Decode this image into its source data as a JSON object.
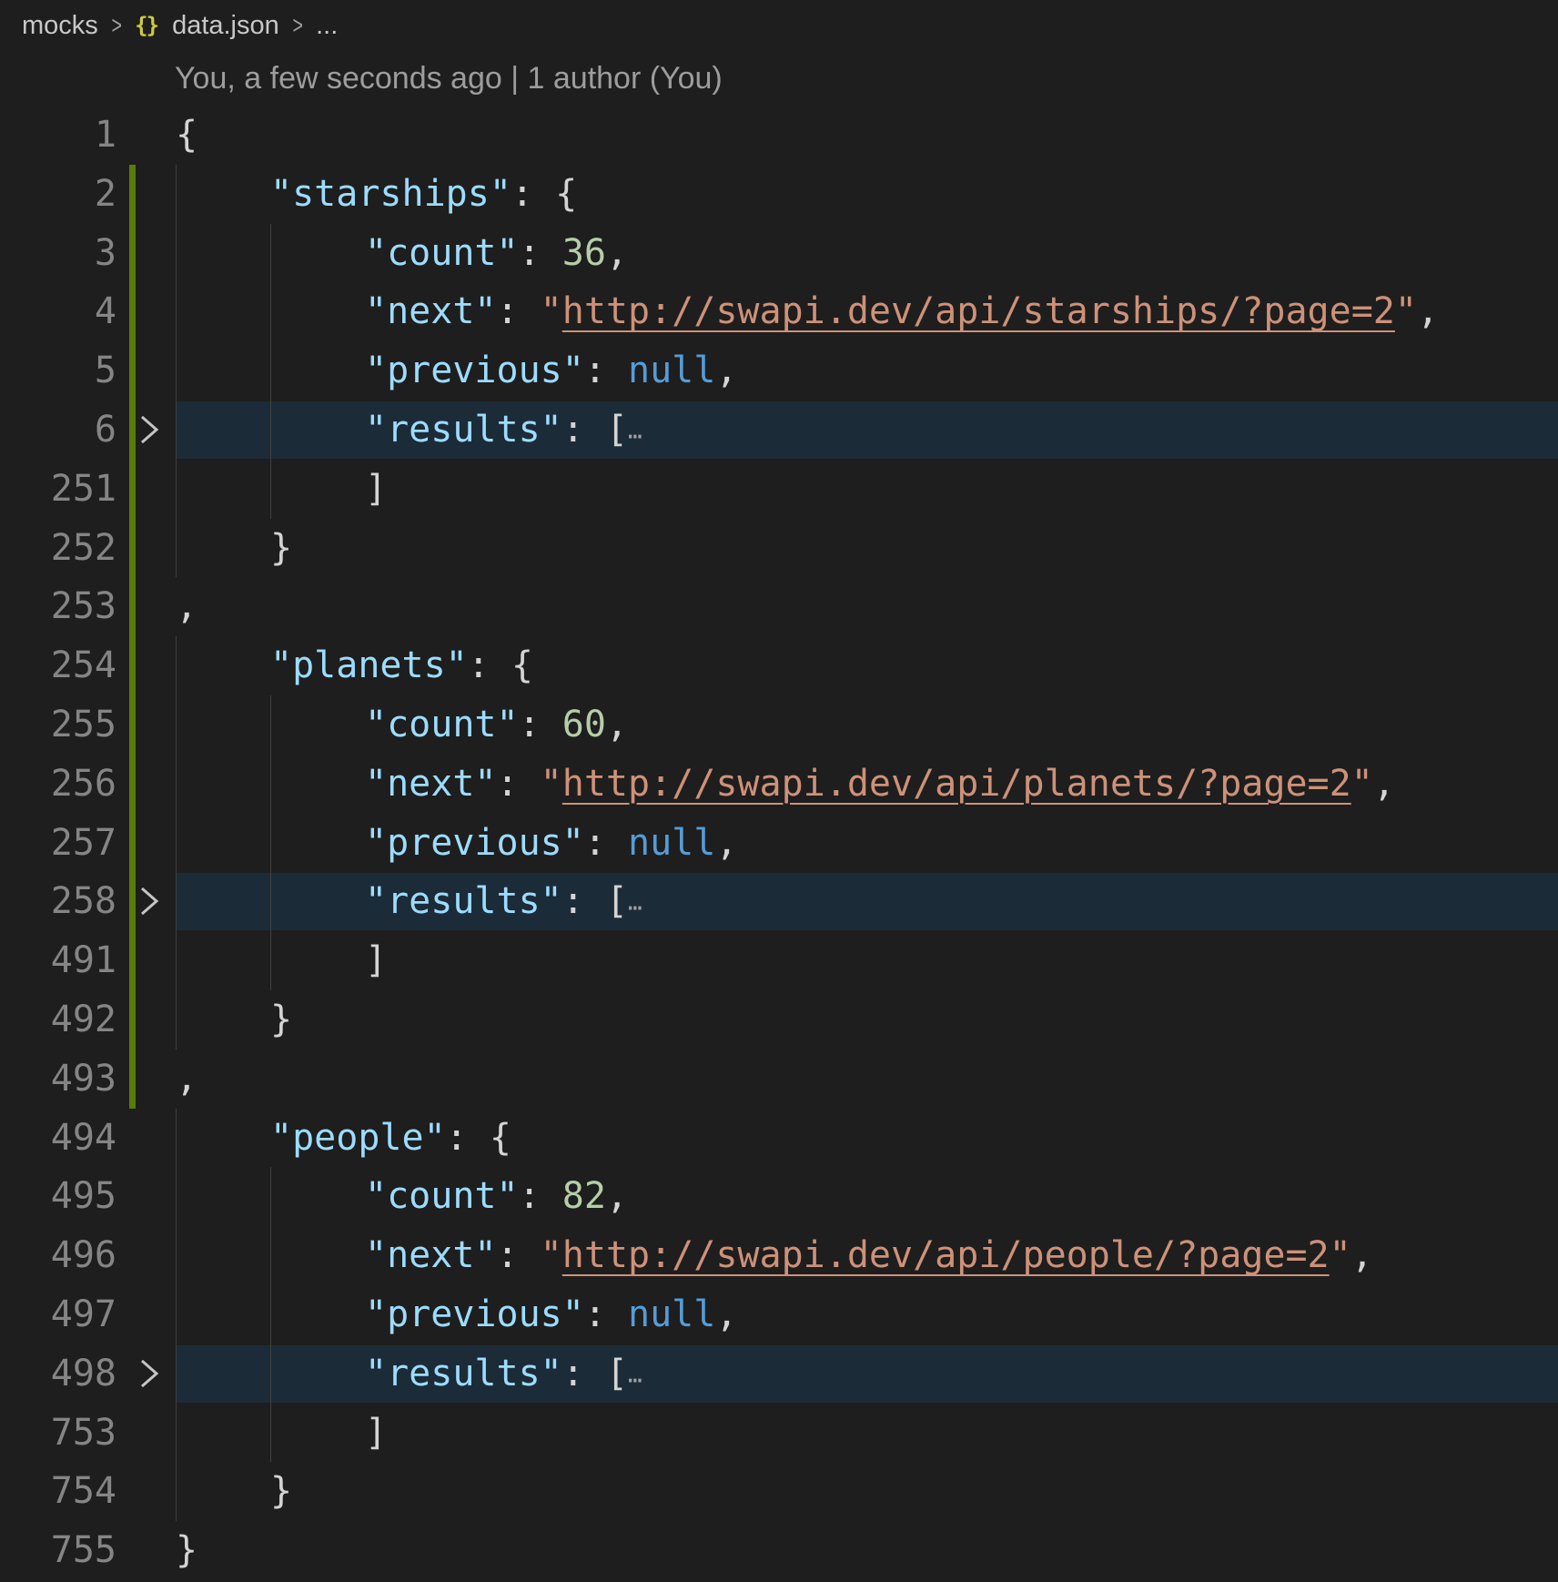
{
  "breadcrumb": {
    "folder": "mocks",
    "file_icon": "{}",
    "file": "data.json",
    "trail": "..."
  },
  "blame": "You, a few seconds ago | 1 author (You)",
  "lines": [
    {
      "n": "1",
      "indent": 0,
      "tokens": [
        [
          "punc",
          "{"
        ]
      ]
    },
    {
      "n": "2",
      "indent": 1,
      "bar": true,
      "tokens": [
        [
          "key",
          "\"starships\""
        ],
        [
          "punc",
          ": {"
        ]
      ]
    },
    {
      "n": "3",
      "indent": 2,
      "bar": true,
      "tokens": [
        [
          "key",
          "\"count\""
        ],
        [
          "punc",
          ": "
        ],
        [
          "num",
          "36"
        ],
        [
          "punc",
          ","
        ]
      ]
    },
    {
      "n": "4",
      "indent": 2,
      "bar": true,
      "tokens": [
        [
          "key",
          "\"next\""
        ],
        [
          "punc",
          ": "
        ],
        [
          "str",
          "\""
        ],
        [
          "url",
          "http://swapi.dev/api/starships/?page=2"
        ],
        [
          "str",
          "\""
        ],
        [
          "punc",
          ","
        ]
      ]
    },
    {
      "n": "5",
      "indent": 2,
      "bar": true,
      "tokens": [
        [
          "key",
          "\"previous\""
        ],
        [
          "punc",
          ": "
        ],
        [
          "kw",
          "null"
        ],
        [
          "punc",
          ","
        ]
      ]
    },
    {
      "n": "6",
      "indent": 2,
      "bar": true,
      "fold": true,
      "hl": true,
      "tokens": [
        [
          "key",
          "\"results\""
        ],
        [
          "punc",
          ": ["
        ],
        [
          "ellipsis",
          "…"
        ]
      ]
    },
    {
      "n": "251",
      "indent": 2,
      "bar": true,
      "tokens": [
        [
          "punc",
          "]"
        ]
      ]
    },
    {
      "n": "252",
      "indent": 1,
      "bar": true,
      "tokens": [
        [
          "punc",
          "}"
        ]
      ]
    },
    {
      "n": "253",
      "indent": 0,
      "bar": true,
      "tokens": [
        [
          "punc",
          ","
        ]
      ]
    },
    {
      "n": "254",
      "indent": 1,
      "bar": true,
      "tokens": [
        [
          "key",
          "\"planets\""
        ],
        [
          "punc",
          ": {"
        ]
      ]
    },
    {
      "n": "255",
      "indent": 2,
      "bar": true,
      "tokens": [
        [
          "key",
          "\"count\""
        ],
        [
          "punc",
          ": "
        ],
        [
          "num",
          "60"
        ],
        [
          "punc",
          ","
        ]
      ]
    },
    {
      "n": "256",
      "indent": 2,
      "bar": true,
      "tokens": [
        [
          "key",
          "\"next\""
        ],
        [
          "punc",
          ": "
        ],
        [
          "str",
          "\""
        ],
        [
          "url",
          "http://swapi.dev/api/planets/?page=2"
        ],
        [
          "str",
          "\""
        ],
        [
          "punc",
          ","
        ]
      ]
    },
    {
      "n": "257",
      "indent": 2,
      "bar": true,
      "tokens": [
        [
          "key",
          "\"previous\""
        ],
        [
          "punc",
          ": "
        ],
        [
          "kw",
          "null"
        ],
        [
          "punc",
          ","
        ]
      ]
    },
    {
      "n": "258",
      "indent": 2,
      "bar": true,
      "fold": true,
      "hl": true,
      "tokens": [
        [
          "key",
          "\"results\""
        ],
        [
          "punc",
          ": ["
        ],
        [
          "ellipsis",
          "…"
        ]
      ]
    },
    {
      "n": "491",
      "indent": 2,
      "bar": true,
      "tokens": [
        [
          "punc",
          "]"
        ]
      ]
    },
    {
      "n": "492",
      "indent": 1,
      "bar": true,
      "tokens": [
        [
          "punc",
          "}"
        ]
      ]
    },
    {
      "n": "493",
      "indent": 0,
      "bar": true,
      "tokens": [
        [
          "punc",
          ","
        ]
      ]
    },
    {
      "n": "494",
      "indent": 1,
      "tokens": [
        [
          "key",
          "\"people\""
        ],
        [
          "punc",
          ": {"
        ]
      ]
    },
    {
      "n": "495",
      "indent": 2,
      "tokens": [
        [
          "key",
          "\"count\""
        ],
        [
          "punc",
          ": "
        ],
        [
          "num",
          "82"
        ],
        [
          "punc",
          ","
        ]
      ]
    },
    {
      "n": "496",
      "indent": 2,
      "tokens": [
        [
          "key",
          "\"next\""
        ],
        [
          "punc",
          ": "
        ],
        [
          "str",
          "\""
        ],
        [
          "url",
          "http://swapi.dev/api/people/?page=2"
        ],
        [
          "str",
          "\""
        ],
        [
          "punc",
          ","
        ]
      ]
    },
    {
      "n": "497",
      "indent": 2,
      "tokens": [
        [
          "key",
          "\"previous\""
        ],
        [
          "punc",
          ": "
        ],
        [
          "kw",
          "null"
        ],
        [
          "punc",
          ","
        ]
      ]
    },
    {
      "n": "498",
      "indent": 2,
      "fold": true,
      "hl": true,
      "tokens": [
        [
          "key",
          "\"results\""
        ],
        [
          "punc",
          ": ["
        ],
        [
          "ellipsis",
          "…"
        ]
      ]
    },
    {
      "n": "753",
      "indent": 2,
      "tokens": [
        [
          "punc",
          "]"
        ]
      ]
    },
    {
      "n": "754",
      "indent": 1,
      "tokens": [
        [
          "punc",
          "}"
        ]
      ]
    },
    {
      "n": "755",
      "indent": 0,
      "tokens": [
        [
          "punc",
          "}"
        ]
      ]
    }
  ],
  "colors": {
    "background": "#1e1e1e",
    "key": "#9cdcfe",
    "number": "#b5cea8",
    "string": "#ce9178",
    "keyword": "#569cd6",
    "punctuation": "#d4d4d4",
    "line_number": "#858585",
    "git_added_bar": "#587c0c",
    "folded_highlight": "#1c2b38",
    "json_icon": "#cbcb41"
  },
  "icons": {
    "breadcrumb_separator": "chevron-right-icon",
    "file_type": "json-braces-icon",
    "fold": "chevron-right-icon"
  }
}
